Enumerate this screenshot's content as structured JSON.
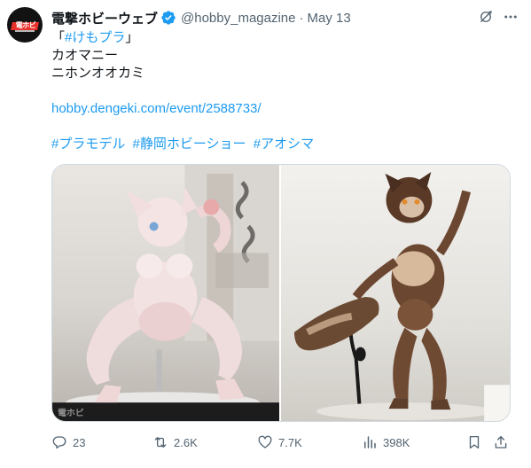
{
  "tweet": {
    "display_name": "電撃ホビーウェブ",
    "handle": "@hobby_magazine",
    "separator": "·",
    "date": "May 13",
    "avatar_logo_text": "電ホビ",
    "body": {
      "line1_open": "「",
      "line1_hashtag": "#けもプラ",
      "line1_close": "」",
      "line2": "カオマニー",
      "line3": "ニホンオオカミ",
      "link": "hobby.dengeki.com/event/2588733/",
      "hashtags": [
        "#プラモデル",
        "#静岡ホビーショー",
        "#アオシマ"
      ]
    },
    "media": {
      "left_watermark": "電ホビ"
    },
    "actions": {
      "reply_count": "23",
      "retweet_count": "2.6K",
      "like_count": "7.7K",
      "view_count": "398K"
    },
    "icons": {
      "top": [
        "grok-icon",
        "more-icon"
      ],
      "actions": [
        "reply-icon",
        "retweet-icon",
        "like-icon",
        "views-icon",
        "bookmark-icon",
        "share-icon"
      ]
    },
    "colors": {
      "link": "#1d9bf0",
      "verified": "#1d9bf0",
      "secondary_text": "#536471",
      "primary_text": "#0f1419"
    }
  }
}
